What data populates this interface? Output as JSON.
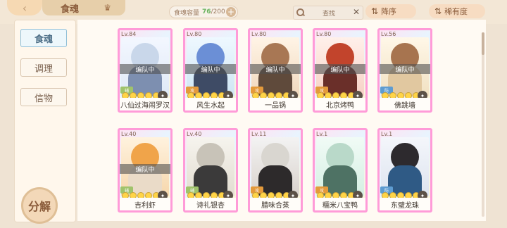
{
  "header": {
    "back_icon": "back-arrow-icon",
    "title": "食魂",
    "capacity_label": "食魂容量",
    "capacity_current": "76",
    "capacity_max": "/200",
    "search_label": "查找",
    "sort_label": "降序",
    "rarity_label": "稀有度"
  },
  "sidebar": {
    "tabs": [
      {
        "label": "食魂",
        "active": true
      },
      {
        "label": "调理",
        "active": false
      },
      {
        "label": "信物",
        "active": false
      }
    ],
    "decompose_label": "分解"
  },
  "cards": [
    {
      "level": "Lv.84",
      "name": "八仙过海闹罗汉",
      "tag": "编队中"
    },
    {
      "level": "Lv.80",
      "name": "风生水起",
      "tag": "编队中"
    },
    {
      "level": "Lv.80",
      "name": "一品锅",
      "tag": "编队中"
    },
    {
      "level": "Lv.80",
      "name": "北京烤鸭",
      "tag": "编队中"
    },
    {
      "level": "Lv.56",
      "name": "佛跳墙",
      "tag": "编队中"
    },
    {
      "level": "Lv.40",
      "name": "吉利虾",
      "tag": "编队中"
    },
    {
      "level": "Lv.40",
      "name": "诗礼银杏",
      "tag": ""
    },
    {
      "level": "Lv.11",
      "name": "腊味合蒸",
      "tag": ""
    },
    {
      "level": "Lv.1",
      "name": "糯米八宝鸭",
      "tag": ""
    },
    {
      "level": "Lv.1",
      "name": "东璧龙珠",
      "tag": ""
    }
  ]
}
